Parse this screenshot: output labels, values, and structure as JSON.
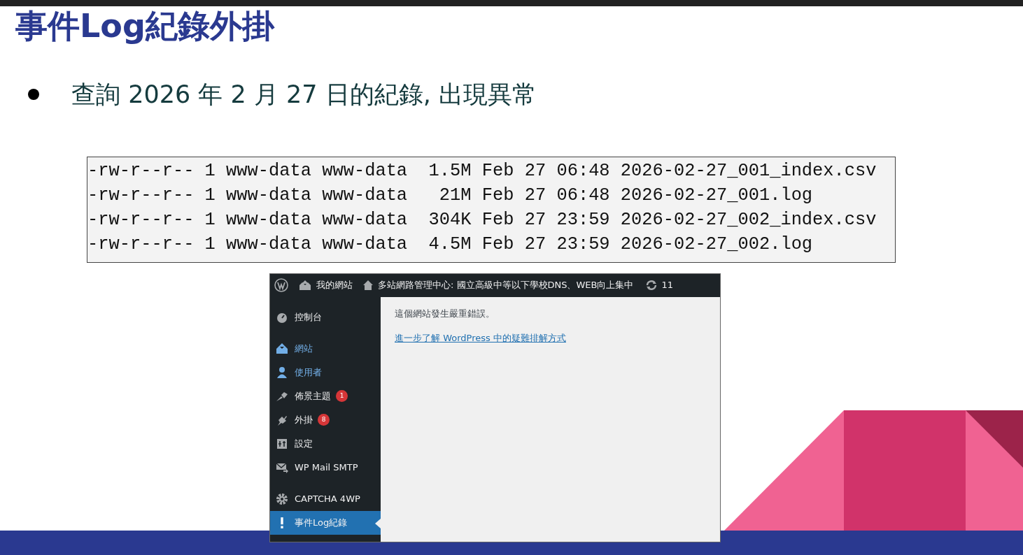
{
  "slide": {
    "title": "事件Log紀錄外掛",
    "bullets": [
      "查詢 2026 年 2 月 27 日的紀錄, 出現異常"
    ]
  },
  "terminal": {
    "lines": [
      "-rw-r--r-- 1 www-data www-data  1.5M Feb 27 06:48 2026-02-27_001_index.csv",
      "-rw-r--r-- 1 www-data www-data   21M Feb 27 06:48 2026-02-27_001.log",
      "-rw-r--r-- 1 www-data www-data  304K Feb 27 23:59 2026-02-27_002_index.csv",
      "-rw-r--r-- 1 www-data www-data  4.5M Feb 27 23:59 2026-02-27_002.log"
    ]
  },
  "wordpress": {
    "admin_bar": {
      "my_sites": "我的網站",
      "site_name": "多站網路管理中心: 國立高級中等以下學校DNS、WEB向上集中",
      "updates": "11"
    },
    "sidebar": {
      "groups": [
        {
          "items": [
            {
              "label": "控制台",
              "selected": false,
              "highlighted": false
            }
          ]
        },
        {
          "items": [
            {
              "label": "網站",
              "selected": false,
              "highlighted": true
            },
            {
              "label": "使用者",
              "selected": false,
              "highlighted": true
            },
            {
              "label": "佈景主題",
              "selected": false,
              "highlighted": false,
              "badge": "1"
            },
            {
              "label": "外掛",
              "selected": false,
              "highlighted": false,
              "badge": "8"
            },
            {
              "label": "設定",
              "selected": false,
              "highlighted": false
            },
            {
              "label": "WP Mail SMTP",
              "selected": false,
              "highlighted": false
            }
          ]
        },
        {
          "items": [
            {
              "label": "CAPTCHA 4WP",
              "selected": false,
              "highlighted": false
            },
            {
              "label": "事件Log紀錄",
              "selected": true,
              "highlighted": false
            }
          ]
        }
      ]
    },
    "content": {
      "message": "這個網站發生嚴重錯誤。",
      "link": "進一步了解 WordPress 中的疑難排解方式"
    }
  }
}
